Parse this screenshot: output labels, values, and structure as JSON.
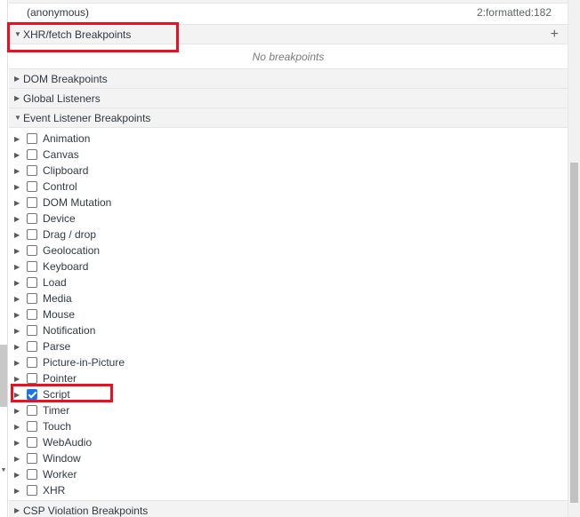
{
  "call_frame": {
    "name": "(anonymous)",
    "location": "2:formatted:182"
  },
  "xhr": {
    "title": "XHR/fetch Breakpoints",
    "add_glyph": "+",
    "empty": "No breakpoints",
    "expanded": true
  },
  "dom": {
    "title": "DOM Breakpoints"
  },
  "global": {
    "title": "Global Listeners"
  },
  "event": {
    "title": "Event Listener Breakpoints",
    "categories": [
      {
        "label": "Animation",
        "checked": false
      },
      {
        "label": "Canvas",
        "checked": false
      },
      {
        "label": "Clipboard",
        "checked": false
      },
      {
        "label": "Control",
        "checked": false
      },
      {
        "label": "DOM Mutation",
        "checked": false
      },
      {
        "label": "Device",
        "checked": false
      },
      {
        "label": "Drag / drop",
        "checked": false
      },
      {
        "label": "Geolocation",
        "checked": false
      },
      {
        "label": "Keyboard",
        "checked": false
      },
      {
        "label": "Load",
        "checked": false
      },
      {
        "label": "Media",
        "checked": false
      },
      {
        "label": "Mouse",
        "checked": false
      },
      {
        "label": "Notification",
        "checked": false
      },
      {
        "label": "Parse",
        "checked": false
      },
      {
        "label": "Picture-in-Picture",
        "checked": false
      },
      {
        "label": "Pointer",
        "checked": false
      },
      {
        "label": "Script",
        "checked": true
      },
      {
        "label": "Timer",
        "checked": false
      },
      {
        "label": "Touch",
        "checked": false
      },
      {
        "label": "WebAudio",
        "checked": false
      },
      {
        "label": "Window",
        "checked": false
      },
      {
        "label": "Worker",
        "checked": false
      },
      {
        "label": "XHR",
        "checked": false
      }
    ]
  },
  "csp": {
    "title": "CSP Violation Breakpoints"
  },
  "colors": {
    "highlight": "#e81123",
    "checkbox_checked": "#1a73e8"
  }
}
